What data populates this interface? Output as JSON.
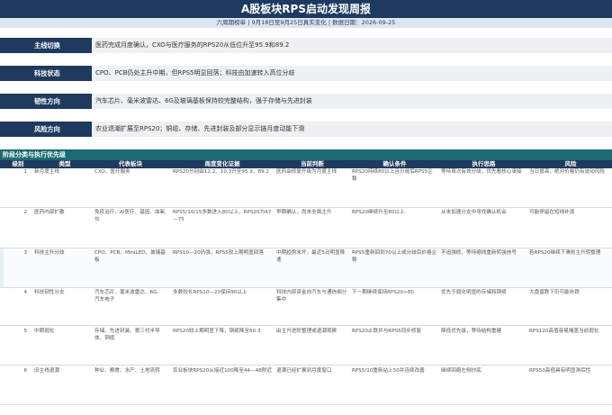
{
  "header": {
    "title": "A股板块RPS启动发现周报",
    "subtitle": "六周期榜单 | 9月18日至9月25日真实变化 | 数据日期：2026-09-25"
  },
  "summary": [
    {
      "label": "主线切换",
      "text": "医药完成月度确认，CXO与医疗服务的RPS20从低位升至95.9和89.2"
    },
    {
      "label": "科技状态",
      "text": "CPO、PCB仍处主升中期，但RPS5明显回落；科技由加速转入高位分歧"
    },
    {
      "label": "韧性方向",
      "text": "汽车芯片、毫米波雷达、6G及玻璃基板保持较完整结构，强于存储与先进封装"
    },
    {
      "label": "风险方向",
      "text": "农业退潮扩展至RPS20；铜缆、存储、先进封装及部分显示链月度动能下滑"
    }
  ],
  "table": {
    "section_title": "阶段分类与执行优先级",
    "headers": [
      "级别",
      "类型",
      "代表板块",
      "周度变化证据",
      "当前判断",
      "确认条件",
      "执行思路",
      "风险"
    ],
    "rows": [
      {
        "level": "1",
        "type": "新月度主线",
        "boards": "CXO、医疗服务",
        "evidence": "RPS20分别由12.2、10.3升至95.9、89.2",
        "judgement": "医药由修复升级为月度主线",
        "condition": "RPS20持续80以上且分歧后RPS5企稳",
        "execution": "等待首次有效分歧，优先看核心承接",
        "risk": "当日冒高，绝对价格仍有波动风险"
      },
      {
        "level": "2",
        "type": "医药内部扩散",
        "boards": "免疫治疗、AI医疗、基因、血氧仪",
        "evidence": "RPS5/10/15多数进入80以上，RPS20为47—75",
        "judgement": "早期确认，尚未全面主升",
        "condition": "RPS20继续升至80以上",
        "execution": "从未加速分支中寻找确认机会",
        "risk": "可能停留在短线补涨"
      },
      {
        "level": "3",
        "type": "科技主升分歧",
        "boards": "CPO、PCB、MiniLED、玻璃基板",
        "evidence": "RPS10—20仍强，RPS5较上期明显回落",
        "judgement": "中期趋势未坏，最近5日明显降速",
        "condition": "RPS5重新回到70以上或分歧后价格企稳",
        "execution": "不追强修，等待缩线重新转强信号",
        "risk": "若RPS20继续下滑则主升转整理"
      },
      {
        "level": "4",
        "type": "科技韧性分支",
        "boards": "汽车芯片、毫米波雷达、6G、汽车电子",
        "evidence": "多数较长RPS10—20保持90以上",
        "judgement": "科技内部资金向汽车与通信细分集中",
        "condition": "下一期继续保持RPS20>80",
        "execution": "优先于弱化明显的存储和铜缆",
        "risk": "大盘普跌下仍可能补跌"
      },
      {
        "level": "5",
        "type": "中期弱化",
        "boards": "存储、先进封装、第三代半导体、铜缆",
        "evidence": "RPS20较上期明显下降，铜缆降至60.3",
        "judgement": "由主升进阶整理或退潮观察",
        "condition": "RPS20止跌并与RPS5同步修复",
        "execution": "降低优先级，等待结构重建",
        "risk": "RPS120高值容易掩盖当前弱化"
      },
      {
        "level": "6",
        "type": "旧主线退潮",
        "boards": "种业、粮食、水产、土地流转",
        "evidence": "农业板块RPS20从接近100降至44—48附近",
        "judgement": "退潮已经扩展到月度窗口",
        "condition": "RPS5/10重新站上50并连续改善",
        "execution": "继续回避左侧抄底",
        "risk": "RPS50高值具有明显滞后性"
      }
    ]
  },
  "colors": {
    "primary": "#1f3a5f",
    "section": "#1a6b72",
    "panel": "#eef1f4"
  }
}
